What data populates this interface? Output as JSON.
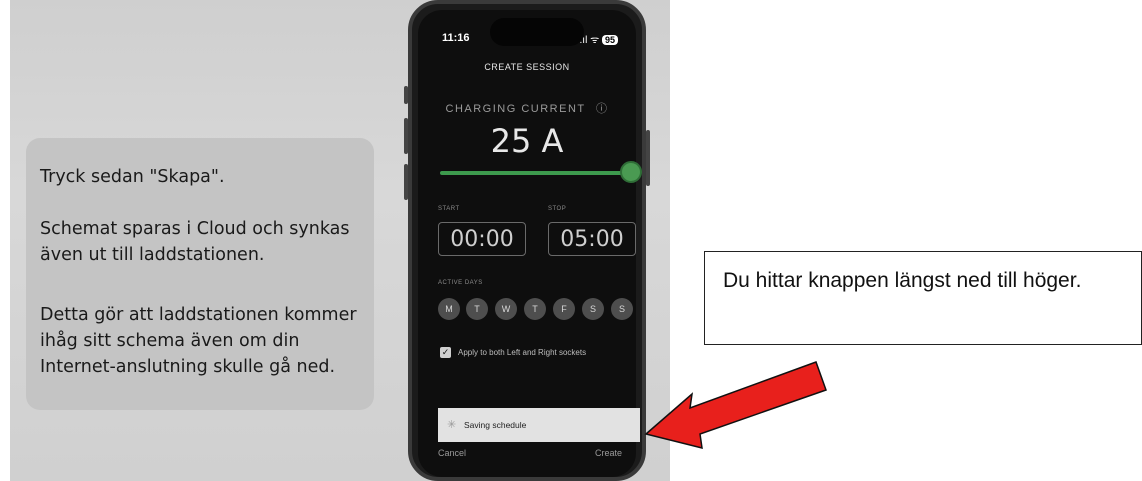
{
  "caption": {
    "line1": "Tryck sedan \"Skapa\".",
    "line2a": "Schemat sparas i Cloud och synkas",
    "line2b": "även ut till laddstationen.",
    "line3a": "Detta gör att laddstationen kommer",
    "line3b": "ihåg sitt schema även om din",
    "line3c": "Internet-anslutning skulle gå ned."
  },
  "phone": {
    "status_time": "11:16",
    "status_icons": ".ıl ᯤ",
    "battery": "95",
    "screen_title": "CREATE SESSION",
    "charging_label": "CHARGING CURRENT",
    "charging_value": "25 A",
    "current_fraction": 1.0,
    "start_label": "START",
    "stop_label": "STOP",
    "start_time": "00:00",
    "stop_time": "05:00",
    "active_days_label": "ACTIVE DAYS",
    "days": [
      "M",
      "T",
      "W",
      "T",
      "F",
      "S",
      "S"
    ],
    "apply_checked": true,
    "apply_text": "Apply to both Left and Right sockets",
    "toast_text": "Saving schedule",
    "cancel_label": "Cancel",
    "create_label": "Create"
  },
  "callout": {
    "text": "Du hittar knappen längst ned till höger."
  },
  "colors": {
    "accent_green": "#4a9a52",
    "arrow_red": "#e8201c"
  }
}
